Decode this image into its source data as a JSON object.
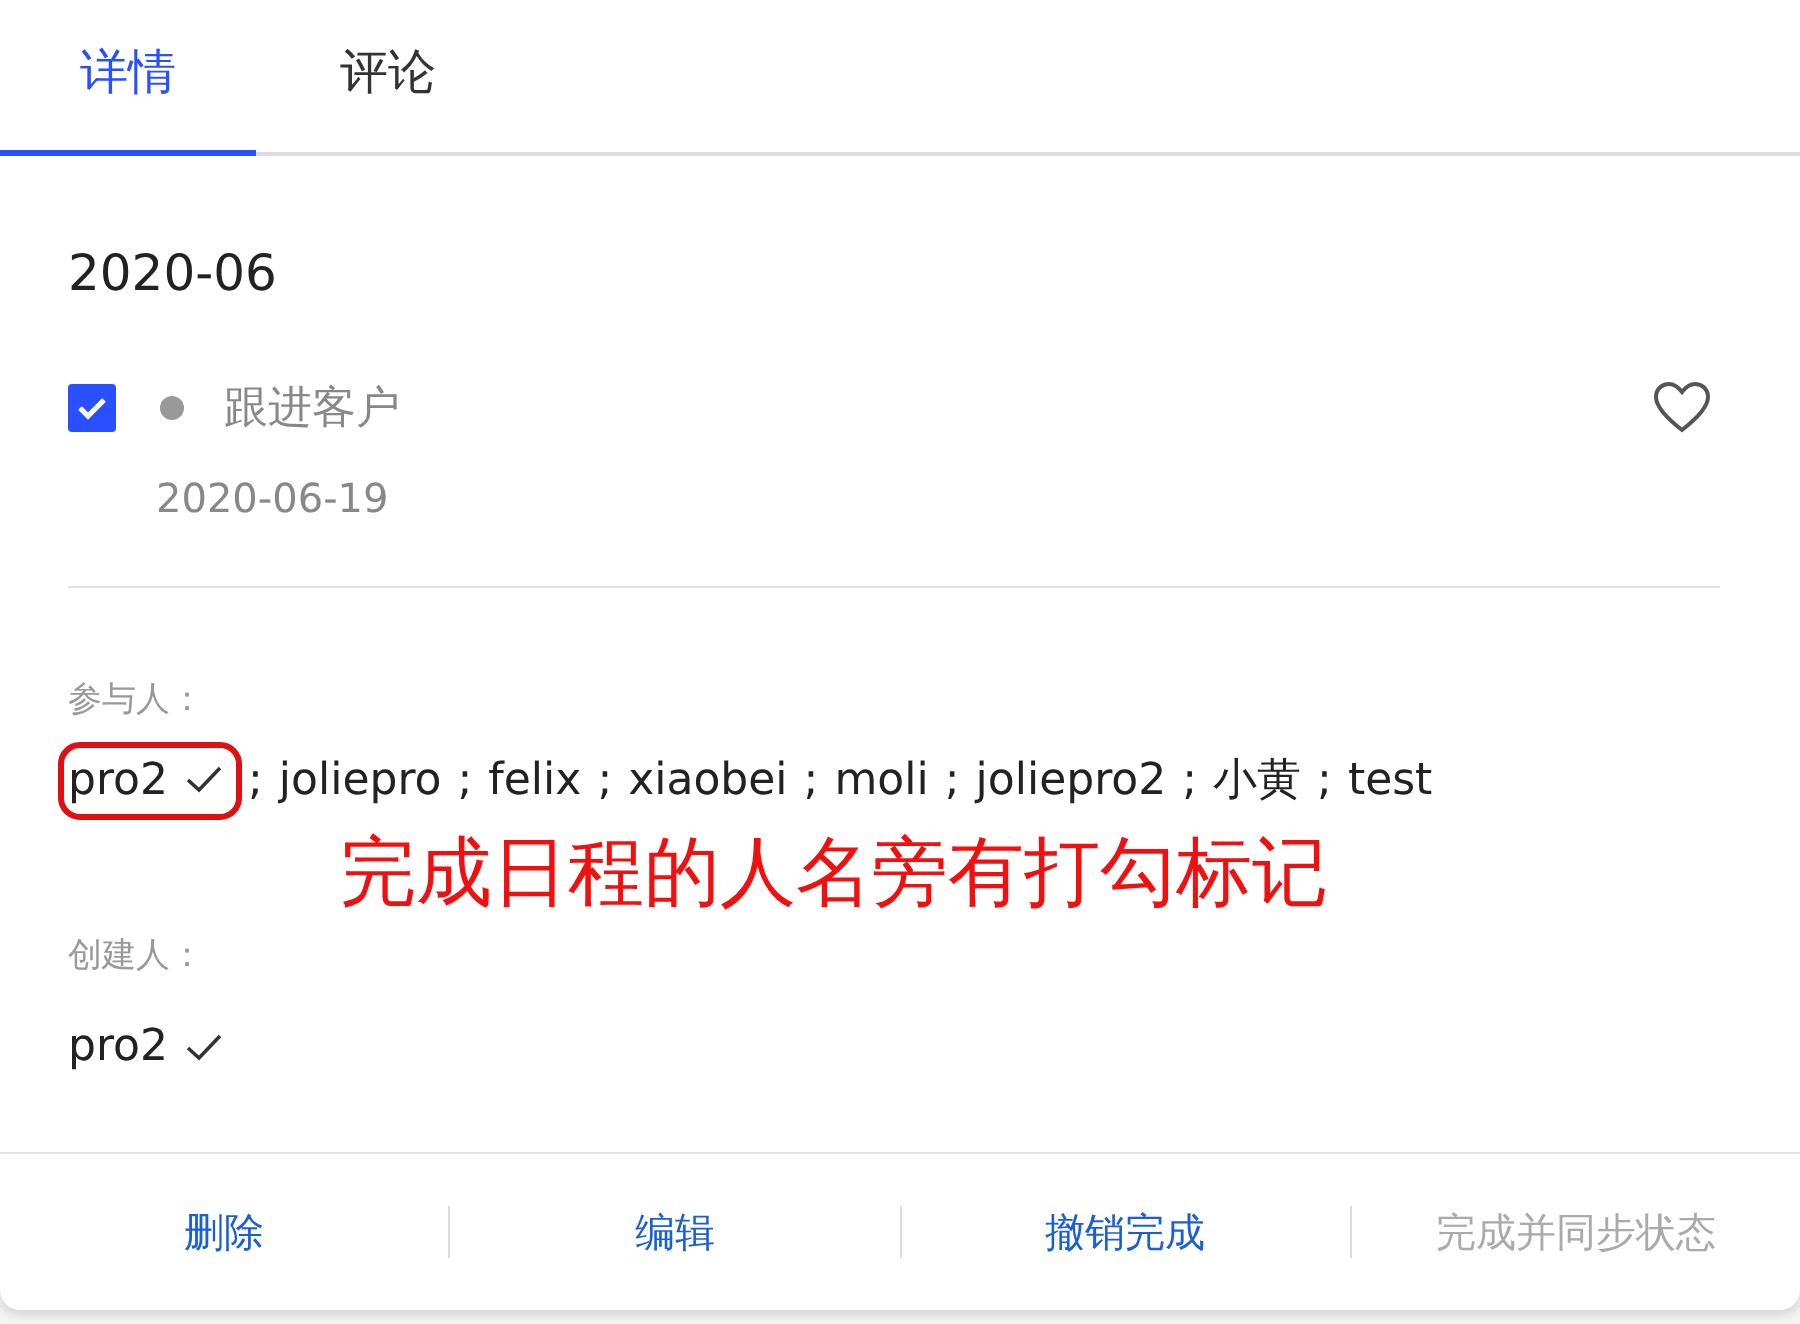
{
  "tabs": [
    {
      "label": "详情",
      "selected": true
    },
    {
      "label": "评论",
      "selected": false
    }
  ],
  "title": "2020-06",
  "task": {
    "checked": true,
    "color": "#999999",
    "name": "跟进客户",
    "date": "2020-06-19",
    "favorite": false
  },
  "participants": {
    "label": "参与人：",
    "separator": ";",
    "people": [
      {
        "name": "pro2",
        "done": true,
        "highlighted": true
      },
      {
        "name": "joliepro",
        "done": false,
        "highlighted": false
      },
      {
        "name": "felix",
        "done": false,
        "highlighted": false
      },
      {
        "name": "xiaobei",
        "done": false,
        "highlighted": false
      },
      {
        "name": "moli",
        "done": false,
        "highlighted": false
      },
      {
        "name": "joliepro2",
        "done": false,
        "highlighted": false
      },
      {
        "name": "小黄",
        "done": false,
        "highlighted": false
      },
      {
        "name": "test",
        "done": false,
        "highlighted": false
      }
    ]
  },
  "annotation": "完成日程的人名旁有打勾标记",
  "creator": {
    "label": "创建人：",
    "name": "pro2",
    "done": true
  },
  "actions": [
    {
      "label": "删除",
      "disabled": false
    },
    {
      "label": "编辑",
      "disabled": false
    },
    {
      "label": "撤销完成",
      "disabled": false
    },
    {
      "label": "完成并同步状态",
      "disabled": true
    }
  ]
}
